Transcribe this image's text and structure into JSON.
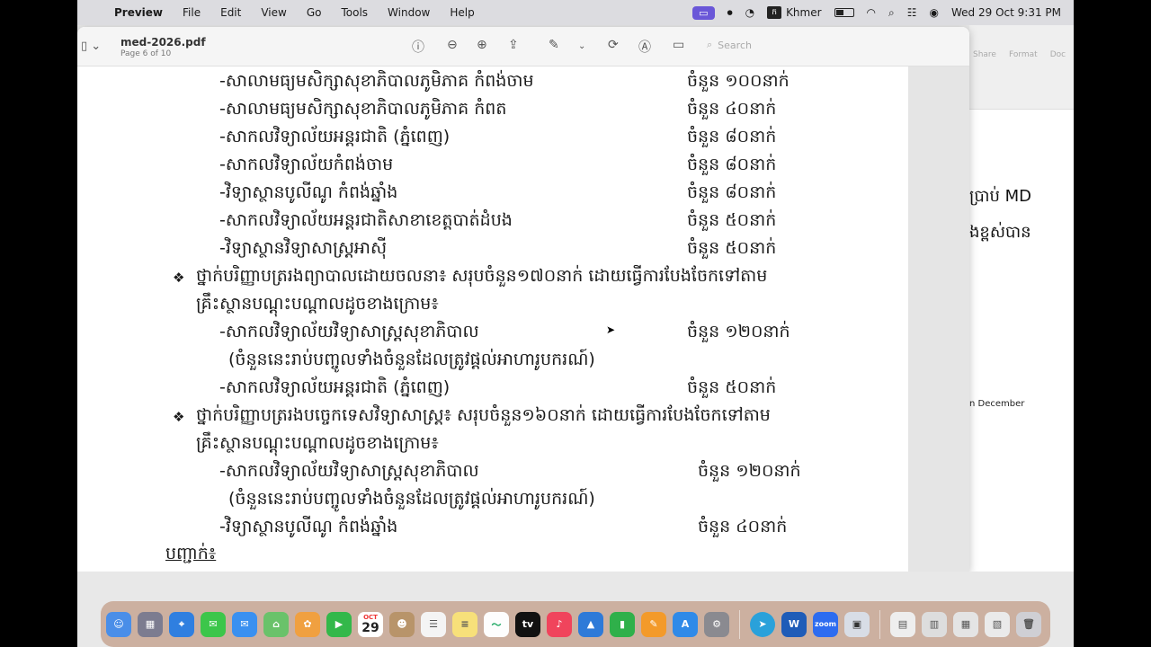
{
  "menubar": {
    "app_name": "Preview",
    "menus": [
      "File",
      "Edit",
      "View",
      "Go",
      "Tools",
      "Window",
      "Help"
    ],
    "input_language": "Khmer",
    "clock": "Wed 29 Oct  9:31 PM"
  },
  "window": {
    "title": "med-2026.pdf",
    "subtitle": "Page 6 of 10",
    "search_placeholder": "Search"
  },
  "document": {
    "lines": [
      {
        "text": "-សាលាមធ្យមសិក្សាសុខាភិបាលភូមិភាគ កំពង់ចាម",
        "count": "ចំនួន ១០០នាក់"
      },
      {
        "text": "-សាលាមធ្យមសិក្សាសុខាភិបាលភូមិភាគ កំពត",
        "count": "ចំនួន ៤០នាក់"
      },
      {
        "text": "-សាកលវិទ្យាល័យអន្តរជាតិ (ភ្នំពេញ)",
        "count": "ចំនួន ៨០នាក់"
      },
      {
        "text": "-សាកលវិទ្យាល័យកំពង់ចាម",
        "count": "ចំនួន ៨០នាក់"
      },
      {
        "text": "-វិទ្យាស្ថានបូលីណូ កំពង់ឆ្នាំង",
        "count": "ចំនួន ៨០នាក់"
      },
      {
        "text": "-សាកលវិទ្យាល័យអន្តរជាតិសាខាខេត្តបាត់ដំបង",
        "count": "ចំនួន ៥០នាក់"
      },
      {
        "text": "-វិទ្យាស្ថានវិទ្យាសាស្ត្រអាស៊ី",
        "count": "ចំនួន ៥០នាក់"
      }
    ],
    "section1": {
      "heading": "ថ្នាក់បរិញ្ញាបត្ររងព្យាបាលដោយចលនា៖  សរុបចំនួន១៧០នាក់   ដោយធ្វើការបែងចែកទៅតាម",
      "heading2": "គ្រឹះស្ថានបណ្តុះបណ្តាលដូចខាងក្រោម៖",
      "items": [
        {
          "text": "-សាកលវិទ្យាល័យវិទ្យាសាស្ត្រសុខាភិបាល",
          "count": "ចំនួន ១២០នាក់"
        },
        {
          "text": "(ចំនួននេះរាប់បញ្ចូលទាំងចំនួនដែលត្រូវផ្តល់អាហារូបករណ៍)",
          "count": ""
        },
        {
          "text": "-សាកលវិទ្យាល័យអន្តរជាតិ (ភ្នំពេញ)",
          "count": "ចំនួន ៥០នាក់"
        }
      ]
    },
    "section2": {
      "heading": "ថ្នាក់បរិញ្ញាបត្ររងបច្ចេកទេសវិទ្យាសាស្ត្រ៖   សរុបចំនួន១៦០នាក់   ដោយធ្វើការបែងចែកទៅតាម",
      "heading2": "គ្រឹះស្ថានបណ្តុះបណ្តាលដូចខាងក្រោម៖",
      "items": [
        {
          "text": "-សាកលវិទ្យាល័យវិទ្យាសាស្ត្រសុខាភិបាល",
          "count": "ចំនួន ១២០នាក់"
        },
        {
          "text": "(ចំនួននេះរាប់បញ្ចូលទាំងចំនួនដែលត្រូវផ្តល់អាហារូបករណ៍)",
          "count": ""
        },
        {
          "text": "-វិទ្យាស្ថានបូលីណូ កំពង់ឆ្នាំង",
          "count": "ចំនួន ៤០នាក់"
        }
      ]
    },
    "footer_label": "បញ្ជាក់៖"
  },
  "background_window": {
    "toolbar": [
      "Share",
      "Format",
      "Doc"
    ],
    "text1": "ប្រាប់ MD",
    "text2": "ងខ្ពស់បាន",
    "text3": "n December"
  },
  "dock": {
    "calendar_month": "OCT",
    "calendar_day": "29",
    "apps": [
      "Finder",
      "Launchpad",
      "Safari",
      "Messages",
      "Mail",
      "Maps",
      "Photos",
      "FaceTime",
      "Calendar",
      "Contacts",
      "Reminders",
      "Notes",
      "Freeform",
      "TV",
      "Music",
      "Keynote",
      "Numbers",
      "Pages",
      "App Store",
      "System Settings",
      "Telegram",
      "Word",
      "Zoom",
      "Preview",
      "Downloads",
      "Trash"
    ]
  },
  "colors": {
    "ime_accent": "#6a57d8",
    "dock_bg": "#b48264"
  }
}
